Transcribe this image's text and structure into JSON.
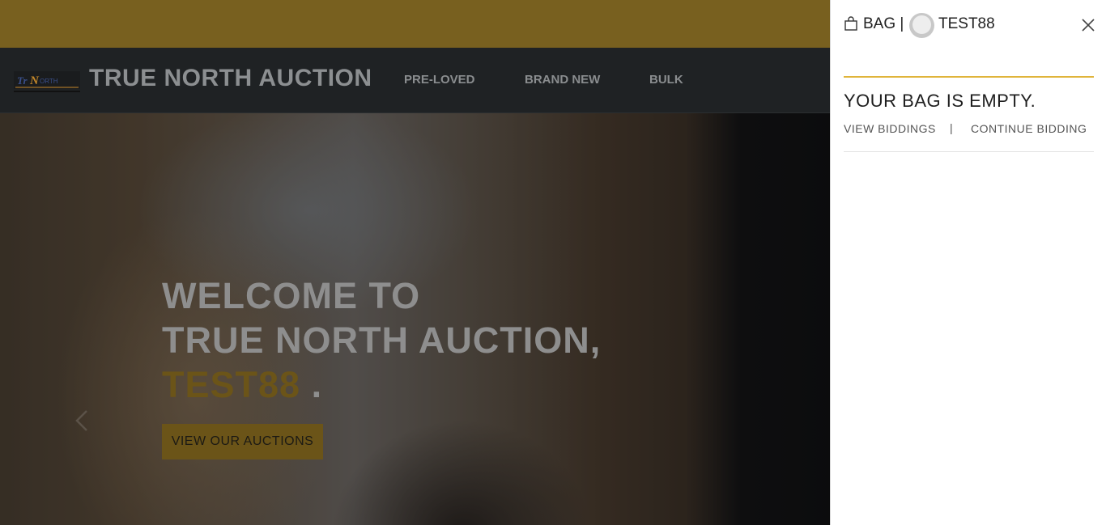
{
  "header": {
    "brand": "TRUE NORTH AUCTION",
    "logo_alt": "TRUE NORTH",
    "nav": [
      "PRE-LOVED",
      "BRAND NEW",
      "BULK"
    ]
  },
  "hero": {
    "line1": "WELCOME TO",
    "line2": "TRUE NORTH AUCTION,",
    "username": "TEST88",
    "dot": ".",
    "cta_label": "VIEW OUR AUCTIONS"
  },
  "drawer": {
    "bag_label": "BAG |",
    "username": "TEST88",
    "empty_title": "YOUR BAG IS EMPTY.",
    "view_biddings": "VIEW BIDDINGS",
    "separator": "|",
    "continue_bidding": "CONTINUE BIDDING"
  },
  "colors": {
    "accent": "#e0b43a",
    "topband": "#78601f",
    "navbar": "#1f2224"
  },
  "icons": [
    "shopping-bag-icon",
    "avatar",
    "close-icon",
    "chevron-left-icon"
  ]
}
